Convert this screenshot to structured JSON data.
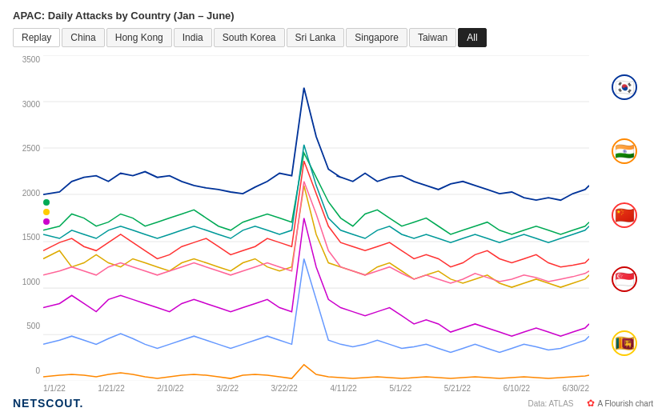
{
  "title": "APAC: Daily Attacks by Country (Jan – June)",
  "tabs": [
    {
      "label": "Replay",
      "id": "replay",
      "active": false
    },
    {
      "label": "China",
      "id": "china",
      "active": false
    },
    {
      "label": "Hong Kong",
      "id": "hong-kong",
      "active": false
    },
    {
      "label": "India",
      "id": "india",
      "active": false
    },
    {
      "label": "South Korea",
      "id": "south-korea",
      "active": false
    },
    {
      "label": "Sri Lanka",
      "id": "sri-lanka",
      "active": false
    },
    {
      "label": "Singapore",
      "id": "singapore",
      "active": false
    },
    {
      "label": "Taiwan",
      "id": "taiwan",
      "active": false
    },
    {
      "label": "All",
      "id": "all",
      "active": true
    }
  ],
  "yAxis": {
    "labels": [
      "0",
      "500",
      "1000",
      "1500",
      "2000",
      "2500",
      "3000",
      "3500"
    ]
  },
  "xAxis": {
    "labels": [
      "1/1/22",
      "1/21/22",
      "2/10/22",
      "3/2/22",
      "3/22/22",
      "4/11/22",
      "5/1/22",
      "5/21/22",
      "6/10/22",
      "6/30/22"
    ]
  },
  "flags": [
    {
      "country": "South Korea",
      "emoji": "🇰🇷"
    },
    {
      "country": "India",
      "emoji": "🇮🇳"
    },
    {
      "country": "China",
      "emoji": "🇨🇳"
    },
    {
      "country": "Singapore",
      "emoji": "🇸🇬"
    },
    {
      "country": "Sri Lanka",
      "emoji": "🇱🇰"
    }
  ],
  "bottom": {
    "logo": "NETSCOUT.",
    "data_label": "Data: ATLAS",
    "flourish_label": "A Flourish chart"
  },
  "colors": {
    "dark_blue": "#003399",
    "green": "#00aa55",
    "red": "#ff3333",
    "yellow": "#ffcc00",
    "magenta": "#cc00cc",
    "light_blue": "#66aaff",
    "orange": "#ff8800",
    "teal": "#009999",
    "pink": "#ff6699"
  }
}
